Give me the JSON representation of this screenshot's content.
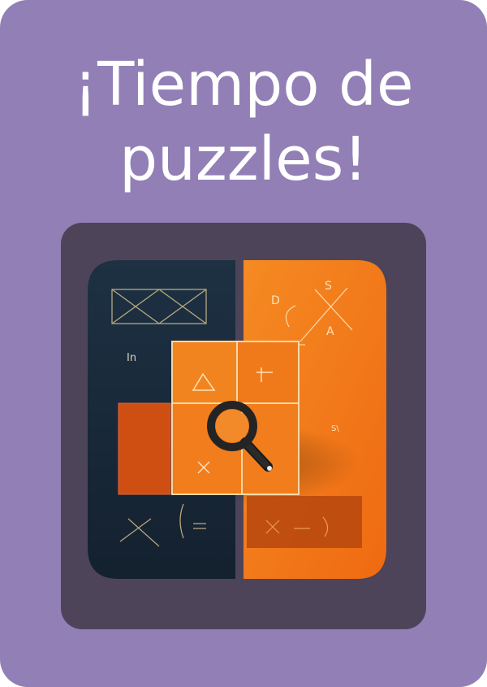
{
  "card": {
    "title": "¡Tiempo de\npuzzles!",
    "image_icon": "puzzle-search-illustration-icon"
  },
  "colors": {
    "card_background": "#927fb6",
    "frame_background": "#4d4459",
    "title_text": "#ffffff",
    "navy": "#1b2a3a",
    "orange": "#f47c1d",
    "dark_orange": "#cf4f12"
  }
}
